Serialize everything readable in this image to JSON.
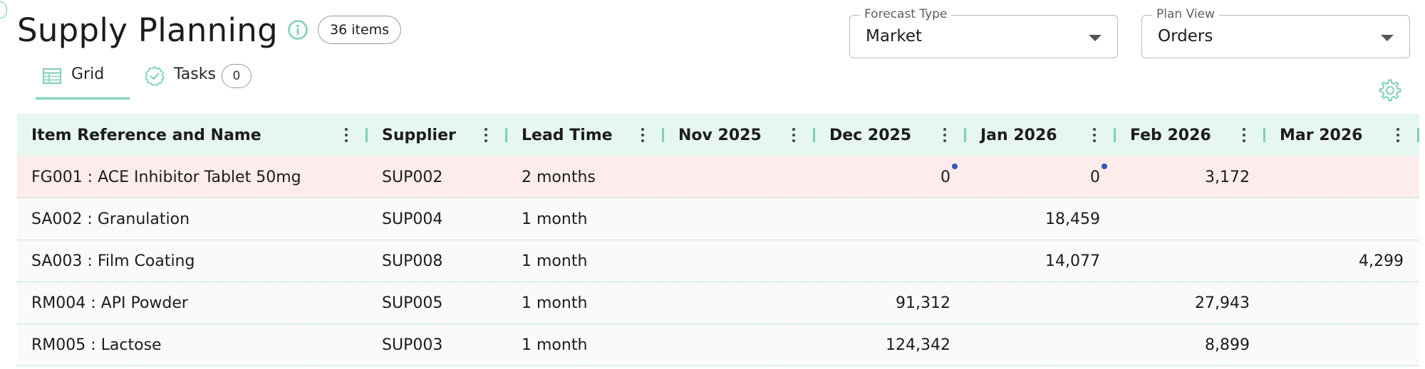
{
  "header": {
    "title": "Supply Planning",
    "item_count": "36 items"
  },
  "tabs": [
    {
      "label": "Grid",
      "active": true
    },
    {
      "label": "Tasks",
      "badge": "0",
      "active": false
    }
  ],
  "filters": {
    "forecast_type": {
      "label": "Forecast Type",
      "value": "Market"
    },
    "plan_view": {
      "label": "Plan View",
      "value": "Orders"
    }
  },
  "grid": {
    "columns": [
      "Item Reference and Name",
      "Supplier",
      "Lead Time",
      "Nov 2025",
      "Dec 2025",
      "Jan 2026",
      "Feb 2026",
      "Mar 2026"
    ],
    "rows": [
      {
        "item": "FG001 : ACE Inhibitor Tablet 50mg",
        "supplier": "SUP002",
        "lead_time": "2 months",
        "nov": "",
        "dec": "0",
        "jan": "0",
        "feb": "3,172",
        "mar": ""
      },
      {
        "item": "SA002 : Granulation",
        "supplier": "SUP004",
        "lead_time": "1 month",
        "nov": "",
        "dec": "",
        "jan": "18,459",
        "feb": "",
        "mar": ""
      },
      {
        "item": "SA003 : Film Coating",
        "supplier": "SUP008",
        "lead_time": "1 month",
        "nov": "",
        "dec": "",
        "jan": "14,077",
        "feb": "",
        "mar": "4,299"
      },
      {
        "item": "RM004 : API Powder",
        "supplier": "SUP005",
        "lead_time": "1 month",
        "nov": "",
        "dec": "91,312",
        "jan": "",
        "feb": "27,943",
        "mar": ""
      },
      {
        "item": "RM005 : Lactose",
        "supplier": "SUP003",
        "lead_time": "1 month",
        "nov": "",
        "dec": "124,342",
        "jan": "",
        "feb": "8,899",
        "mar": ""
      }
    ]
  },
  "colors": {
    "accent": "#7dd1b2",
    "header_bg": "#e5f7ef",
    "highlight_row": "#fdecec",
    "indicator_dot": "#2f5bb5"
  },
  "icons": {
    "info": "info-icon",
    "grid_tab": "table-icon",
    "tasks_tab": "check-badge-icon",
    "settings": "gear-icon",
    "column_menu": "kebab-menu-icon",
    "dropdown": "caret-down-icon"
  }
}
